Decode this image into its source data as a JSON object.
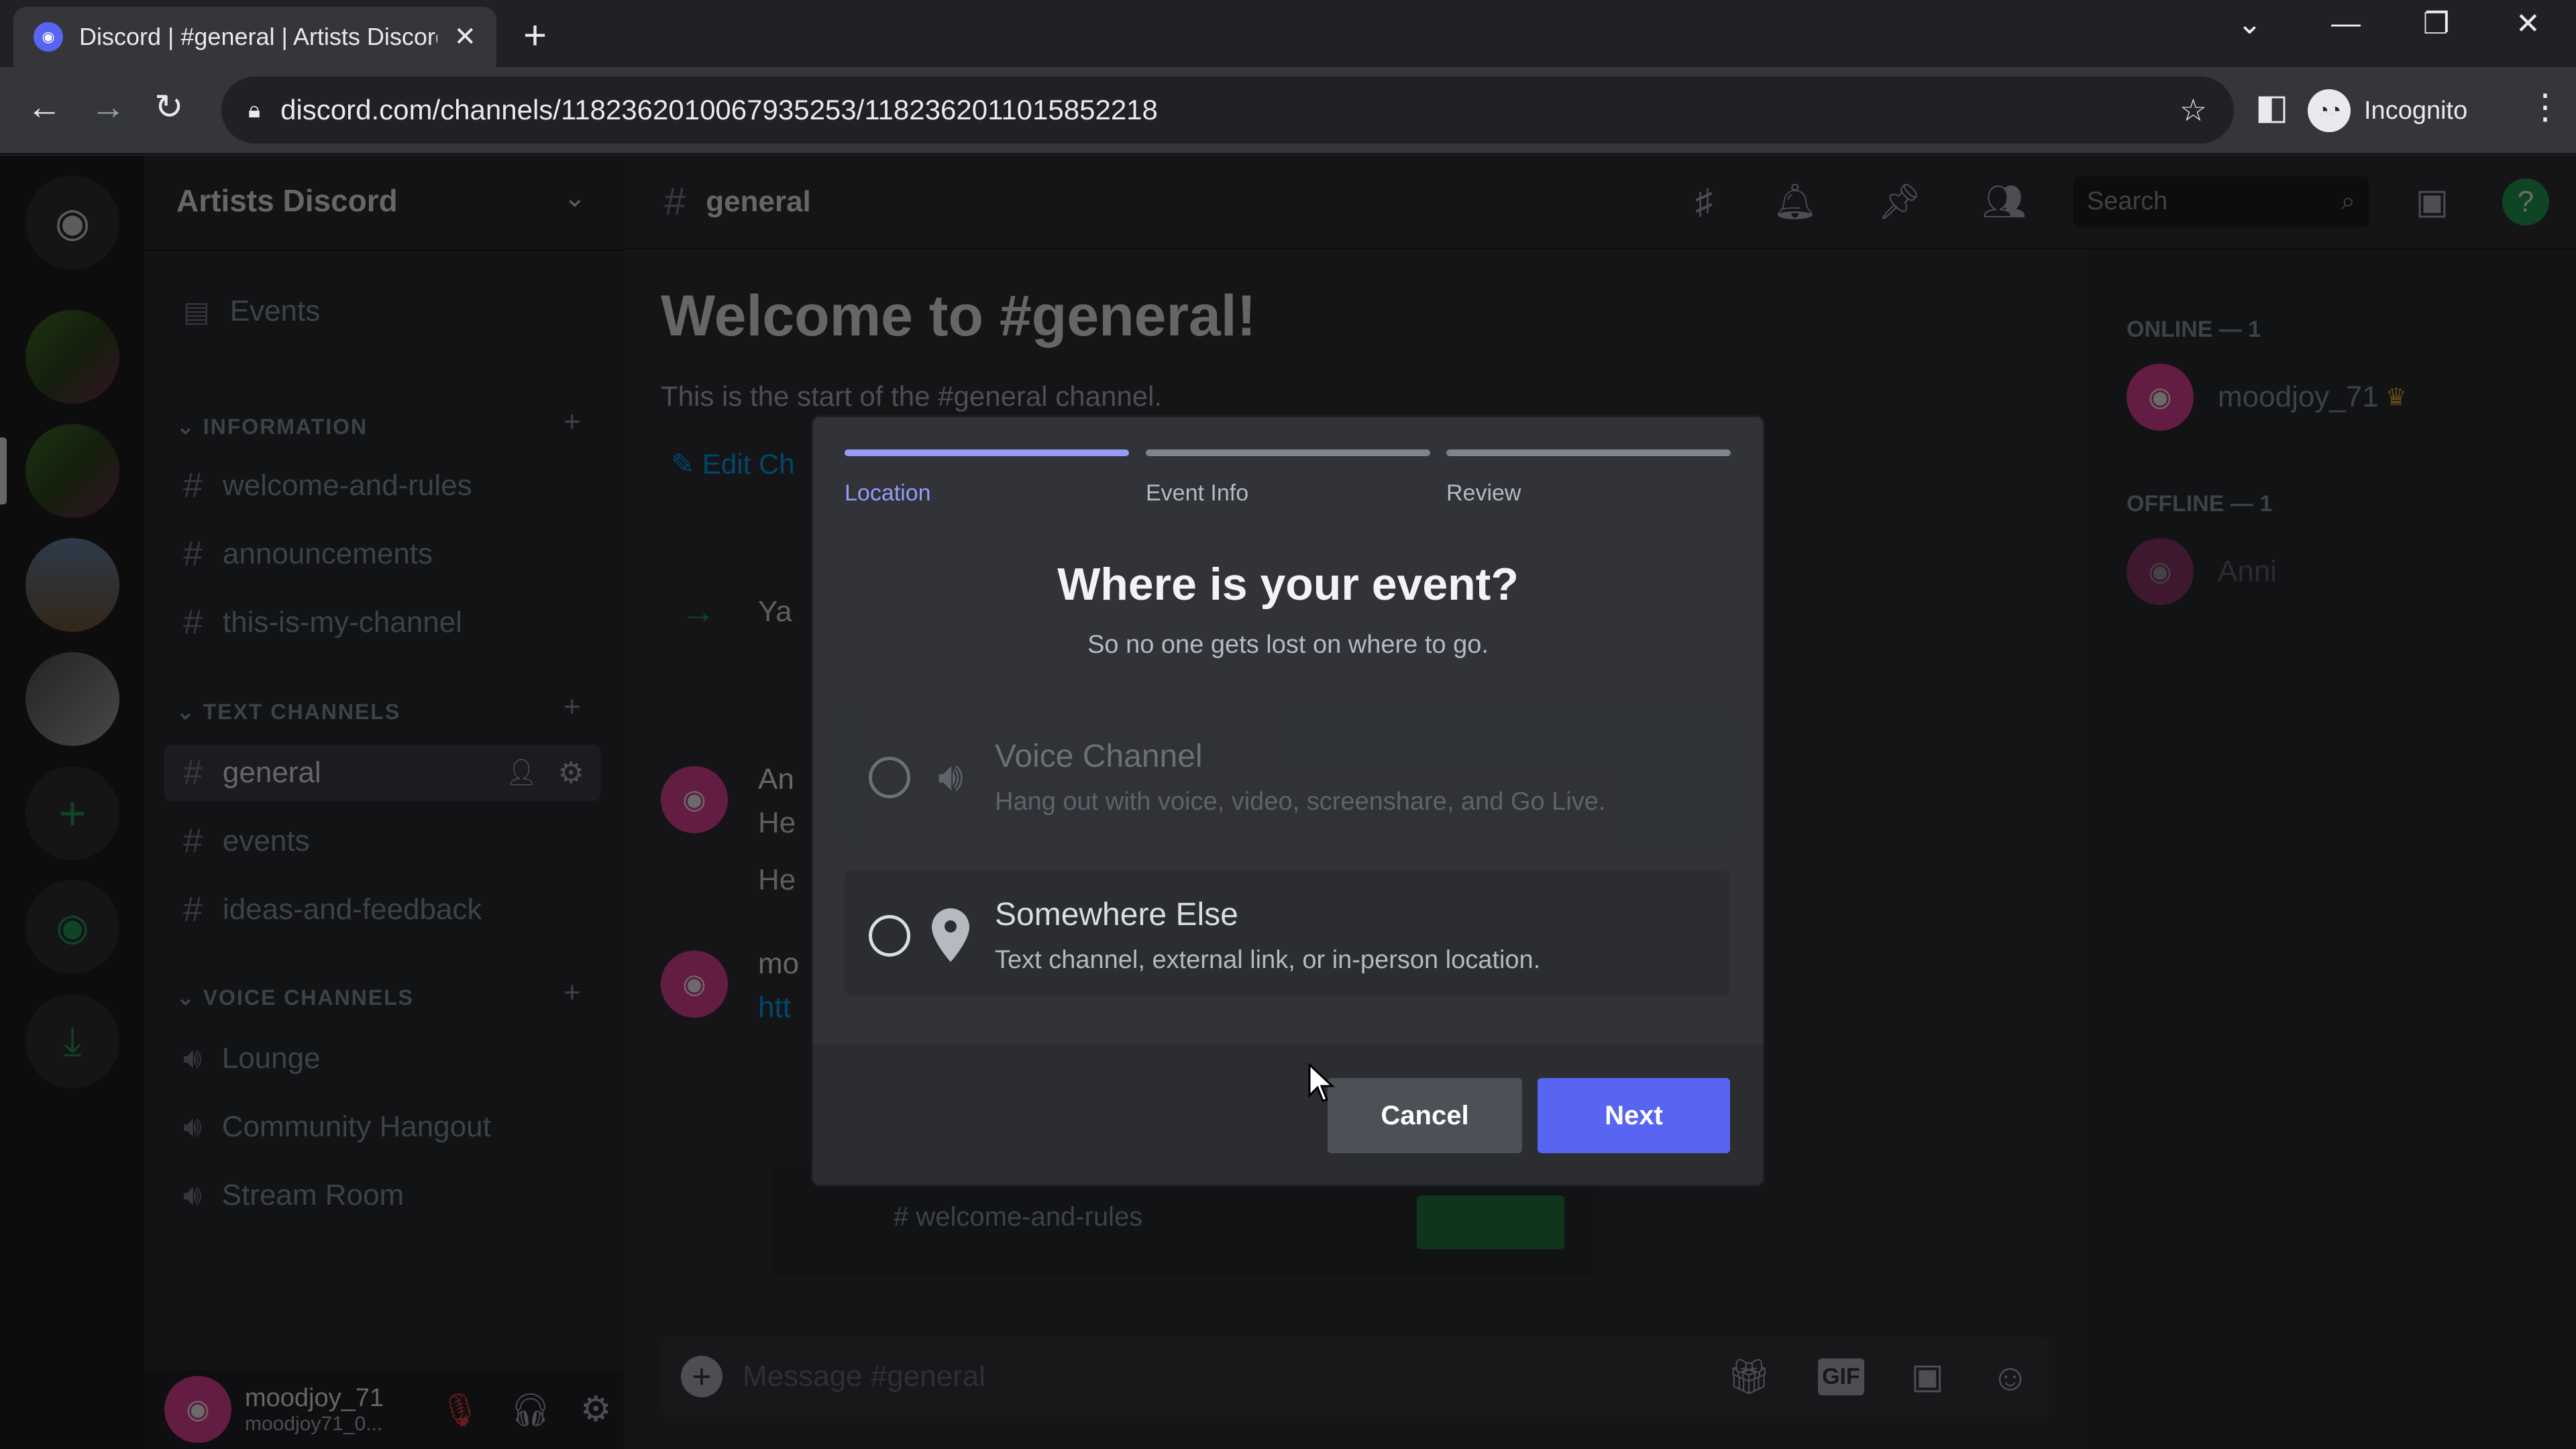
{
  "browser": {
    "tab_title": "Discord | #general | Artists Discord",
    "url": "discord.com/channels/1182362010067935253/1182362011015852218",
    "profile_label": "Incognito"
  },
  "server": {
    "name": "Artists Discord",
    "events_label": "Events",
    "categories": [
      {
        "name": "INFORMATION",
        "channels": [
          "welcome-and-rules",
          "announcements",
          "this-is-my-channel"
        ]
      },
      {
        "name": "TEXT CHANNELS",
        "channels": [
          "general",
          "events",
          "ideas-and-feedback"
        ]
      },
      {
        "name": "VOICE CHANNELS",
        "channels": [
          "Lounge",
          "Community Hangout",
          "Stream Room"
        ]
      }
    ]
  },
  "user": {
    "name": "moodjoy_71",
    "tag": "moodjoy71_0..."
  },
  "channel": {
    "name": "general",
    "welcome_title": "Welcome to #general!",
    "welcome_sub": "This is the start of the #general channel.",
    "edit_label": "Edit Ch",
    "search_placeholder": "Search",
    "message_placeholder": "Message #general",
    "fragments": [
      "Ya",
      "An",
      "He",
      "He",
      "mo",
      "htt"
    ],
    "embed_channel": "welcome-and-rules"
  },
  "members": {
    "online_header": "ONLINE — 1",
    "offline_header": "OFFLINE — 1",
    "online": [
      "moodjoy_71"
    ],
    "offline": [
      "Anni"
    ]
  },
  "modal": {
    "steps": [
      {
        "label": "Location",
        "active": true
      },
      {
        "label": "Event Info",
        "active": false
      },
      {
        "label": "Review",
        "active": false
      }
    ],
    "title": "Where is your event?",
    "subtitle": "So no one gets lost on where to go.",
    "options": [
      {
        "title": "Voice Channel",
        "desc": "Hang out with voice, video, screenshare, and Go Live.",
        "icon": "speaker-icon",
        "disabled": true,
        "selected": false
      },
      {
        "title": "Somewhere Else",
        "desc": "Text channel, external link, or in-person location.",
        "icon": "location-pin-icon",
        "disabled": false,
        "selected": false
      }
    ],
    "cancel_label": "Cancel",
    "next_label": "Next"
  },
  "colors": {
    "accent": "#5865f2",
    "active_step": "#949cf7",
    "modal_bg": "#313338"
  }
}
